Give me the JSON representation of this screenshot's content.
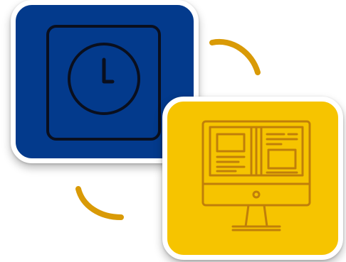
{
  "colors": {
    "clock_tile_bg": "#033a8c",
    "monitor_tile_bg": "#f6c400",
    "clock_icon_stroke": "#0a0f1e",
    "monitor_icon_stroke": "#c07f0a",
    "connector_arc": "#d99a06",
    "tile_border": "#ffffff"
  },
  "icons": {
    "clock_tile_icon": "clock-icon",
    "monitor_tile_icon": "monitor-icon"
  }
}
